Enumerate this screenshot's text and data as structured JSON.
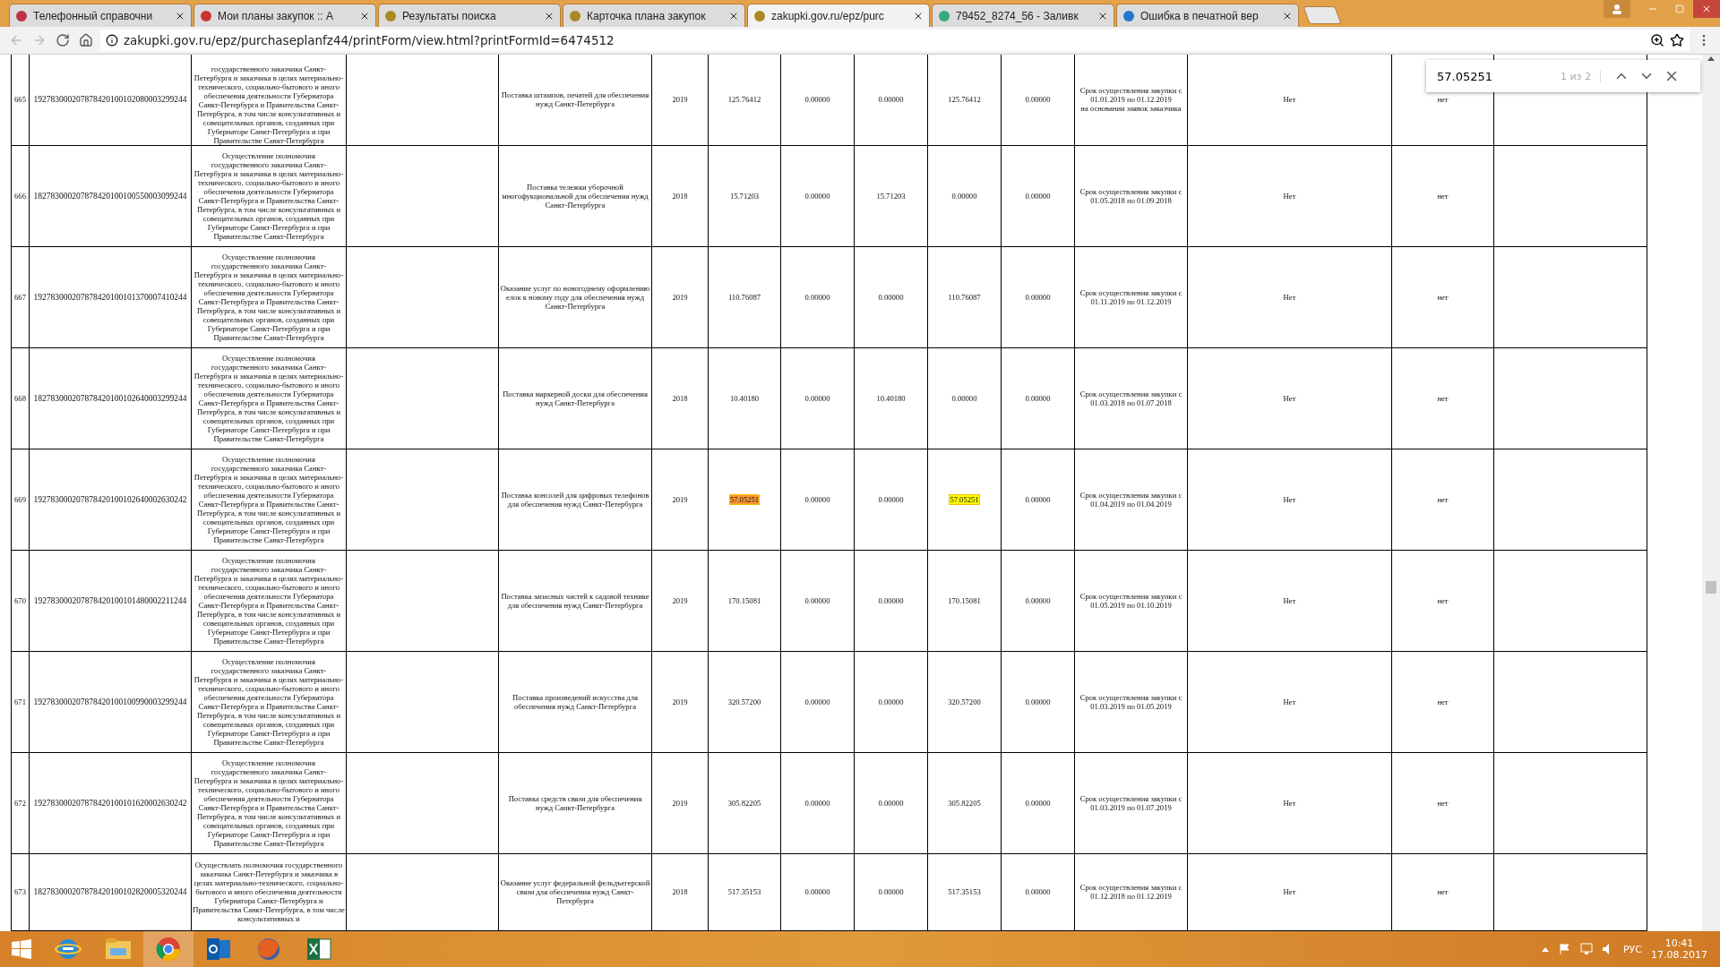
{
  "browser": {
    "tabs": [
      {
        "label": "Телефонный справочни",
        "selected": false
      },
      {
        "label": "Мои планы закупок :: А",
        "selected": false
      },
      {
        "label": "Результаты поиска",
        "selected": false
      },
      {
        "label": "Карточка плана закупок",
        "selected": false
      },
      {
        "label": "zakupki.gov.ru/epz/purc",
        "selected": true
      },
      {
        "label": "79452_8274_56 - Заливк",
        "selected": false
      },
      {
        "label": "Ошибка в печатной вер",
        "selected": false
      }
    ],
    "address": "zakupki.gov.ru/epz/purchaseplanfz44/printForm/view.html?printFormId=6474512"
  },
  "find_bar": {
    "value": "57.05251",
    "count": "1 из 2"
  },
  "table": {
    "rows": [
      {
        "number": "665",
        "code": "192783000207878420100102080003299244",
        "customer": "государственного заказчика Санкт-Петербурга и заказчика в целях материально-технического, социально-бытового и иного обеспечения деятельности Губернатора Санкт-Петербурга и Правительства Санкт-Петербурга, в том числе консультативных и совещательных органов, созданных при Губернаторе Санкт-Петербурга и при Правительстве Санкт-Петербурга",
        "item": "Поставка штампов, печатей для обеспечения нужд Санкт-Петербурга",
        "year": "2019",
        "amounts": [
          {
            "value": "125.76412",
            "found": false,
            "current": false
          },
          {
            "value": "0.00000",
            "found": false,
            "current": false
          },
          {
            "value": "0.00000",
            "found": false,
            "current": false
          },
          {
            "value": "125.76412",
            "found": false,
            "current": false
          },
          {
            "value": "0.00000",
            "found": false,
            "current": false
          }
        ],
        "period": [
          "Срок осуществления закупки с 01.01.2019 по 01.12.2019",
          "на основании заявок заказчика"
        ],
        "column_13": "Нет",
        "column_14": "нет"
      },
      {
        "number": "666",
        "code": "182783000207878420100100550003099244",
        "customer": "Осуществление полномочия государственного заказчика Санкт-Петербурга и заказчика в целях материально-технического, социально-бытового и иного обеспечения деятельности Губернатора Санкт-Петербурга и Правительства Санкт-Петербурга, в том числе консультативных и совещательных органов, созданных при Губернаторе Санкт-Петербурга и при Правительстве Санкт-Петербурга",
        "item": "Поставка тележки уборочной многофукциональной для обеспечения нужд Санкт-Петербурга",
        "year": "2018",
        "amounts": [
          {
            "value": "15.71203",
            "found": false,
            "current": false
          },
          {
            "value": "0.00000",
            "found": false,
            "current": false
          },
          {
            "value": "15.71203",
            "found": false,
            "current": false
          },
          {
            "value": "0.00000",
            "found": false,
            "current": false
          },
          {
            "value": "0.00000",
            "found": false,
            "current": false
          }
        ],
        "period": [
          "Срок осуществления закупки с 01.05.2018 по 01.09.2018"
        ],
        "column_13": "Нет",
        "column_14": "нет"
      },
      {
        "number": "667",
        "code": "192783000207878420100101370007410244",
        "customer": "Осуществление полномочия государственного заказчика Санкт-Петербурга и заказчика в целях материально-технического, социально-бытового и иного обеспечения деятельности Губернатора Санкт-Петербурга и Правительства Санкт-Петербурга, в том числе консультативных и совещательных органов, созданных при Губернаторе Санкт-Петербурга и при Правительстве Санкт-Петербурга",
        "item": "Оказание услуг по новогоднему оформлению елок к новому году для обеспечения нужд Санкт-Петербурга",
        "year": "2019",
        "amounts": [
          {
            "value": "110.76087",
            "found": false,
            "current": false
          },
          {
            "value": "0.00000",
            "found": false,
            "current": false
          },
          {
            "value": "0.00000",
            "found": false,
            "current": false
          },
          {
            "value": "110.76087",
            "found": false,
            "current": false
          },
          {
            "value": "0.00000",
            "found": false,
            "current": false
          }
        ],
        "period": [
          "Срок осуществления закупки с 01.11.2019 по 01.12.2019"
        ],
        "column_13": "Нет",
        "column_14": "нет"
      },
      {
        "number": "668",
        "code": "182783000207878420100102640003299244",
        "customer": "Осуществление полномочия государственного заказчика Санкт-Петербурга и заказчика в целях материально-технического, социально-бытового и иного обеспечения деятельности Губернатора Санкт-Петербурга и Правительства Санкт-Петербурга, в том числе консультативных и совещательных органов, созданных при Губернаторе Санкт-Петербурга и при Правительстве Санкт-Петербурга",
        "item": "Поставка маркерной доски для обеспечения нужд Санкт-Петербурга",
        "year": "2018",
        "amounts": [
          {
            "value": "10.40180",
            "found": false,
            "current": false
          },
          {
            "value": "0.00000",
            "found": false,
            "current": false
          },
          {
            "value": "10.40180",
            "found": false,
            "current": false
          },
          {
            "value": "0.00000",
            "found": false,
            "current": false
          },
          {
            "value": "0.00000",
            "found": false,
            "current": false
          }
        ],
        "period": [
          "Срок осуществления закупки с 01.03.2018 по 01.07.2018"
        ],
        "column_13": "Нет",
        "column_14": "нет"
      },
      {
        "number": "669",
        "code": "192783000207878420100102640002630242",
        "customer": "Осуществление полномочия государственного заказчика Санкт-Петербурга и заказчика в целях материально-технического, социально-бытового и иного обеспечения деятельности Губернатора Санкт-Петербурга и Правительства Санкт-Петербурга, в том числе консультативных и совещательных органов, созданных при Губернаторе Санкт-Петербурга и при Правительстве Санкт-Петербурга",
        "item": "Поставка консолей для цифровых телефонов для обеспечения нужд Санкт-Петербурга",
        "year": "2019",
        "amounts": [
          {
            "value": "57.05251",
            "found": true,
            "current": true
          },
          {
            "value": "0.00000",
            "found": false,
            "current": false
          },
          {
            "value": "0.00000",
            "found": false,
            "current": false
          },
          {
            "value": "57.05251",
            "found": true,
            "current": false
          },
          {
            "value": "0.00000",
            "found": false,
            "current": false
          }
        ],
        "period": [
          "Срок осуществления закупки с 01.04.2019 по 01.04.2019"
        ],
        "column_13": "Нет",
        "column_14": "нет"
      },
      {
        "number": "670",
        "code": "192783000207878420100101480002211244",
        "customer": "Осуществление полномочия государственного заказчика Санкт-Петербурга и заказчика в целях материально-технического, социально-бытового и иного обеспечения деятельности Губернатора Санкт-Петербурга и Правительства Санкт-Петербурга, в том числе консультативных и совещательных органов, созданных при Губернаторе Санкт-Петербурга и при Правительстве Санкт-Петербурга",
        "item": "Поставка запасных частей к садовой технике для обеспечения нужд Санкт-Петербурга",
        "year": "2019",
        "amounts": [
          {
            "value": "170.15081",
            "found": false,
            "current": false
          },
          {
            "value": "0.00000",
            "found": false,
            "current": false
          },
          {
            "value": "0.00000",
            "found": false,
            "current": false
          },
          {
            "value": "170.15081",
            "found": false,
            "current": false
          },
          {
            "value": "0.00000",
            "found": false,
            "current": false
          }
        ],
        "period": [
          "Срок осуществления закупки с 01.05.2019 по 01.10.2019"
        ],
        "column_13": "Нет",
        "column_14": "нет"
      },
      {
        "number": "671",
        "code": "192783000207878420100100990003299244",
        "customer": "Осуществление полномочия государственного заказчика Санкт-Петербурга и заказчика в целях материально-технического, социально-бытового и иного обеспечения деятельности Губернатора Санкт-Петербурга и Правительства Санкт-Петербурга, в том числе консультативных и совещательных органов, созданных при Губернаторе Санкт-Петербурга и при Правительстве Санкт-Петербурга",
        "item": "Поставка произведений искусства для обеспечения нужд Санкт-Петербурга",
        "year": "2019",
        "amounts": [
          {
            "value": "320.57200",
            "found": false,
            "current": false
          },
          {
            "value": "0.00000",
            "found": false,
            "current": false
          },
          {
            "value": "0.00000",
            "found": false,
            "current": false
          },
          {
            "value": "320.57200",
            "found": false,
            "current": false
          },
          {
            "value": "0.00000",
            "found": false,
            "current": false
          }
        ],
        "period": [
          "Срок осуществления закупки с 01.03.2019 по 01.05.2019"
        ],
        "column_13": "Нет",
        "column_14": "нет"
      },
      {
        "number": "672",
        "code": "192783000207878420100101620002630242",
        "customer": "Осуществление полномочия государственного заказчика Санкт-Петербурга и заказчика в целях материально-технического, социально-бытового и иного обеспечения деятельности Губернатора Санкт-Петербурга и Правительства Санкт-Петербурга, в том числе консультативных и совещательных органов, созданных при Губернаторе Санкт-Петербурга и при Правительстве Санкт-Петербурга",
        "item": "Поставка средств связи для обеспечения нужд Санкт-Петербурга",
        "year": "2019",
        "amounts": [
          {
            "value": "305.82205",
            "found": false,
            "current": false
          },
          {
            "value": "0.00000",
            "found": false,
            "current": false
          },
          {
            "value": "0.00000",
            "found": false,
            "current": false
          },
          {
            "value": "305.82205",
            "found": false,
            "current": false
          },
          {
            "value": "0.00000",
            "found": false,
            "current": false
          }
        ],
        "period": [
          "Срок осуществления закупки с 01.03.2019 по 01.07.2019"
        ],
        "column_13": "Нет",
        "column_14": "нет"
      },
      {
        "number": "673",
        "code": "182783000207878420100102820005320244",
        "customer": "Осуществлать полномочия государственного заказчика Санкт-Петербурга и заказчика в целях материально-технического, социально-бытового и иного обеспечения деятельности Губернатора Санкт-Петербурга и Правительства Санкт-Петербурга, в том числе консультативных и",
        "item": "Оказание услуг федеральной фельдъегерской связи для обеспечения нужд Санкт-Петербурга",
        "year": "2018",
        "amounts": [
          {
            "value": "517.35153",
            "found": false,
            "current": false
          },
          {
            "value": "0.00000",
            "found": false,
            "current": false
          },
          {
            "value": "0.00000",
            "found": false,
            "current": false
          },
          {
            "value": "517.35153",
            "found": false,
            "current": false
          },
          {
            "value": "0.00000",
            "found": false,
            "current": false
          }
        ],
        "period": [
          "Срок осуществления закупки с 01.12.2018 по 01.12.2019"
        ],
        "column_13": "Нет",
        "column_14": "нет"
      }
    ]
  },
  "taskbar": {
    "language": "РУС",
    "time": "10:41",
    "date": "17.08.2017"
  }
}
